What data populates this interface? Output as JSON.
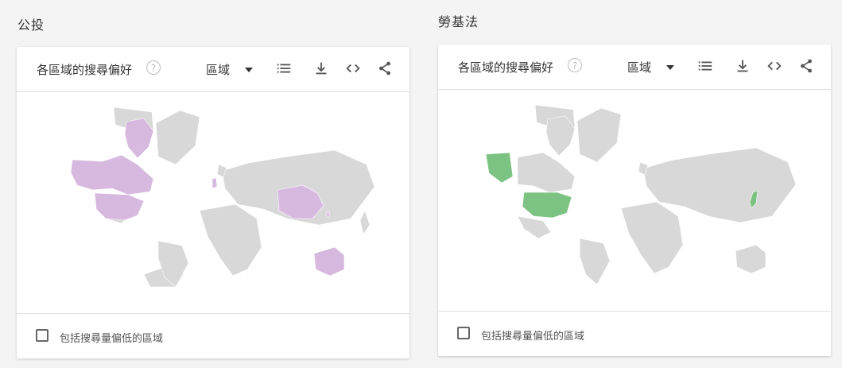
{
  "columns": [
    {
      "term_title": "公投",
      "card_title": "各區域的搜尋偏好",
      "help_glyph": "?",
      "select_value": "區域",
      "footer_label": "包括搜尋量偏低的區域",
      "highlight_color": "#d7b8de",
      "highlighted_regions": [
        "Canada",
        "United States",
        "China",
        "Australia",
        "United Kingdom",
        "Taiwan"
      ]
    },
    {
      "term_title": "勞基法",
      "card_title": "各區域的搜尋偏好",
      "help_glyph": "?",
      "select_value": "區域",
      "footer_label": "包括搜尋量偏低的區域",
      "highlight_color": "#7cc383",
      "highlighted_regions": [
        "Alaska",
        "United States",
        "Japan"
      ]
    }
  ],
  "map_base_color": "#d8d8d8",
  "icons": [
    "help-icon",
    "caret-down-icon",
    "list-icon",
    "download-icon",
    "embed-icon",
    "share-icon"
  ]
}
